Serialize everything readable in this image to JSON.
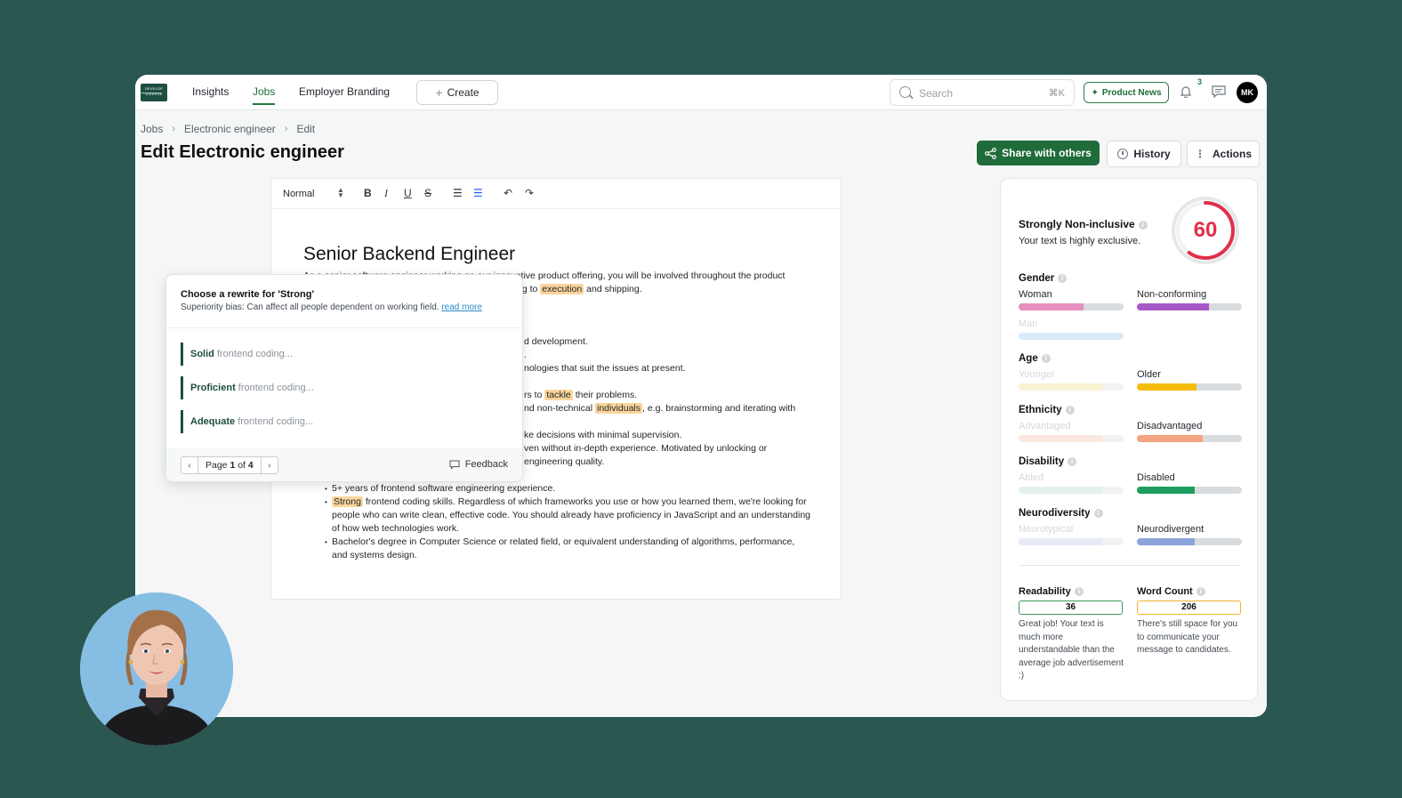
{
  "topbar": {
    "logo_line1": "DEVELOP",
    "logo_line2": "DIVERSE",
    "nav": [
      "Insights",
      "Jobs",
      "Employer Branding"
    ],
    "create_label": "Create",
    "search_placeholder": "Search",
    "search_shortcut": "⌘K",
    "product_news_label": "Product News",
    "notification_count": "3",
    "user_initials": "MK"
  },
  "breadcrumb": [
    "Jobs",
    "Electronic engineer",
    "Edit"
  ],
  "page_title": "Edit Electronic engineer",
  "actions": {
    "share": "Share with others",
    "history": "History",
    "actions": "Actions"
  },
  "editor": {
    "format_select": "Normal",
    "doc_title": "Senior Backend Engineer",
    "intro_a": "As a senior software engineer working on our innovative product offering, you will be involved throughout the product",
    "intro_b": "ng to",
    "intro_hl": "execution",
    "intro_c": "and shipping.",
    "l1": "d development.",
    "l2": ".",
    "l3": "nologies that suit the issues at present.",
    "l4a": "rs to",
    "l4hl": "tackle",
    "l4b": "their problems.",
    "l5a": "nd non-technical",
    "l5hl": "individuals",
    "l5b": ", e.g. brainstorming and iterating with",
    "l6": "ke decisions with minimal supervision.",
    "l7": "ven without in-depth experience. Motivated by unlocking or",
    "l8": "engineering quality.",
    "b1": "5+ years of frontend software engineering experience.",
    "b2hl": "Strong",
    "b2": "frontend coding skills. Regardless of which frameworks you use or how you learned them, we're looking for people who can write clean, effective code. You should already have proficiency in JavaScript and an understanding of how web technologies work.",
    "b3": "Bachelor's degree in Computer Science or related field, or equivalent understanding of algorithms, performance, and systems design."
  },
  "popup": {
    "title": "Choose a rewrite for 'Strong'",
    "subtitle": "Superiority bias: Can affect all people dependent on working field.",
    "read_more": "read more",
    "options": [
      {
        "word": "Solid",
        "rest": "frontend coding..."
      },
      {
        "word": "Proficient",
        "rest": "frontend coding..."
      },
      {
        "word": "Adequate",
        "rest": "frontend coding..."
      }
    ],
    "page_prefix": "Page",
    "page_current": "1",
    "page_of": "of",
    "page_total": "4",
    "feedback": "Feedback"
  },
  "panel": {
    "title": "Strongly Non-inclusive",
    "subtitle": "Your text is highly exclusive.",
    "score": "60",
    "score_fraction": 0.6,
    "categories": [
      {
        "title": "Gender",
        "left": {
          "label": "Woman",
          "value": 0.62,
          "color": "#e78fbf",
          "faded": false
        },
        "right": {
          "label": "Non-conforming",
          "value": 0.69,
          "color": "#a559c6",
          "faded": false
        },
        "third": {
          "label": "Man",
          "value": 1.0,
          "color": "#dbeaf8"
        }
      },
      {
        "title": "Age",
        "left": {
          "label": "Younger",
          "value": 0.8,
          "color": "#f8f3d3",
          "faded": true
        },
        "right": {
          "label": "Older",
          "value": 0.57,
          "color": "#f5bd0a",
          "faded": false
        }
      },
      {
        "title": "Ethnicity",
        "left": {
          "label": "Advantaged",
          "value": 0.8,
          "color": "#fbe8df",
          "faded": true
        },
        "right": {
          "label": "Disadvantaged",
          "value": 0.63,
          "color": "#f3a480",
          "faded": false
        }
      },
      {
        "title": "Disability",
        "left": {
          "label": "Abled",
          "value": 0.8,
          "color": "#e4f1ea",
          "faded": true
        },
        "right": {
          "label": "Disabled",
          "value": 0.55,
          "color": "#1f9d5e",
          "faded": false
        }
      },
      {
        "title": "Neurodiversity",
        "left": {
          "label": "Neurotypical",
          "value": 0.8,
          "color": "#e7eaf6",
          "faded": true
        },
        "right": {
          "label": "Neurodivergent",
          "value": 0.55,
          "color": "#8ca4dc",
          "faded": false
        }
      }
    ],
    "readability": {
      "title": "Readability",
      "value": "36",
      "desc": "Great job! Your text is much more understandable than the average job advertisement :)"
    },
    "word_count": {
      "title": "Word Count",
      "value": "206",
      "desc": "There's still space for you to communicate your message to candidates."
    }
  },
  "colors": {
    "brand_green": "#1f6b3a",
    "background": "#2a5750",
    "score_red": "#e0304a",
    "highlight": "#fbd59c"
  }
}
